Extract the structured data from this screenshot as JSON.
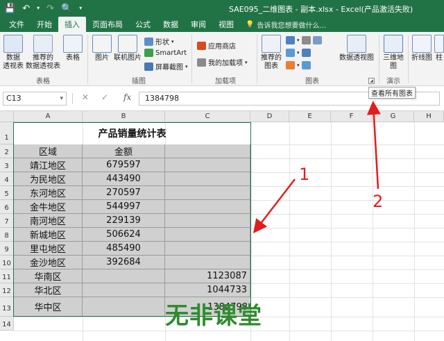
{
  "window": {
    "title": "SAE095_二维图表 - 副本.xlsx - Excel(产品激活失败)"
  },
  "tabs": [
    "文件",
    "开始",
    "插入",
    "页面布局",
    "公式",
    "数据",
    "审阅",
    "视图"
  ],
  "tell_me": "告诉我您想要做什么...",
  "ribbon": {
    "pivot": "数据\n透视表",
    "recommended_pivot": "推荐的\n数据透视表",
    "table": "表格",
    "picture": "图片",
    "online_picture": "联机图片",
    "shapes": "形状",
    "smartart": "SmartArt",
    "screenshot": "屏幕截图",
    "store": "应用商店",
    "my_addins": "我的加载项",
    "recommended_charts": "推荐的\n图表",
    "pivot_chart": "数据透视图",
    "map3d": "三维地\n图",
    "line": "折线图",
    "col": "柱",
    "groups": {
      "tables": "表格",
      "illustrations": "插图",
      "addins": "加载项",
      "charts": "图表",
      "tours": "演示"
    }
  },
  "tooltip": "查看所有图表",
  "formula_bar": {
    "name_box": "C13",
    "value": "1384798"
  },
  "columns": [
    "A",
    "B",
    "C",
    "D",
    "E",
    "F",
    "G",
    "H"
  ],
  "rows": [
    "1",
    "2",
    "3",
    "4",
    "5",
    "6",
    "7",
    "8",
    "9",
    "10",
    "11",
    "12",
    "13",
    "14"
  ],
  "sheet": {
    "title": "产品销量统计表",
    "header": [
      "区域",
      "金额"
    ],
    "data": [
      [
        "靖江地区",
        "679597",
        ""
      ],
      [
        "为民地区",
        "443490",
        ""
      ],
      [
        "东河地区",
        "270597",
        ""
      ],
      [
        "金牛地区",
        "544997",
        ""
      ],
      [
        "南河地区",
        "229139",
        ""
      ],
      [
        "新城地区",
        "506624",
        ""
      ],
      [
        "里屯地区",
        "485490",
        ""
      ],
      [
        "金沙地区",
        "392684",
        ""
      ],
      [
        "华南区",
        "",
        "1123087"
      ],
      [
        "华北区",
        "",
        "1044733"
      ],
      [
        "华中区",
        "",
        "1384798"
      ]
    ]
  },
  "watermark": "无非课堂",
  "annotations": [
    "1",
    "2"
  ],
  "colors": {
    "brand": "#217346",
    "cell_gray": "#d0d0d0",
    "arrow_red": "#e11d1d"
  }
}
